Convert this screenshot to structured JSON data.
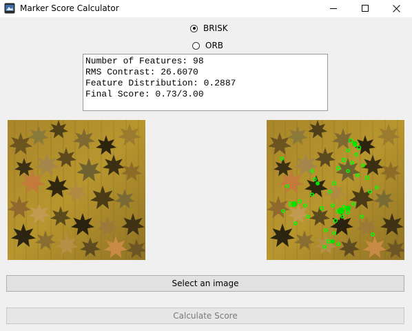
{
  "window": {
    "title": "Marker Score Calculator",
    "icon": "camera-app-icon",
    "controls": [
      "minimize-icon",
      "maximize-icon",
      "close-icon"
    ]
  },
  "detector": {
    "options": [
      {
        "label": "BRISK",
        "selected": true
      },
      {
        "label": "ORB",
        "selected": false
      }
    ]
  },
  "results": {
    "lines": [
      "Number of Features: 98",
      "RMS Contrast: 26.6070",
      "Feature Distribution: 0.2887",
      "Final Score: 0.73/3.00"
    ]
  },
  "images": {
    "original": "maple-leaves-texture",
    "keypoints": "maple-leaves-texture-with-keypoints",
    "keypoint_color": "#00ff00"
  },
  "buttons": {
    "select_label": "Select an image",
    "calculate_label": "Calculate Score",
    "calculate_enabled": false
  }
}
